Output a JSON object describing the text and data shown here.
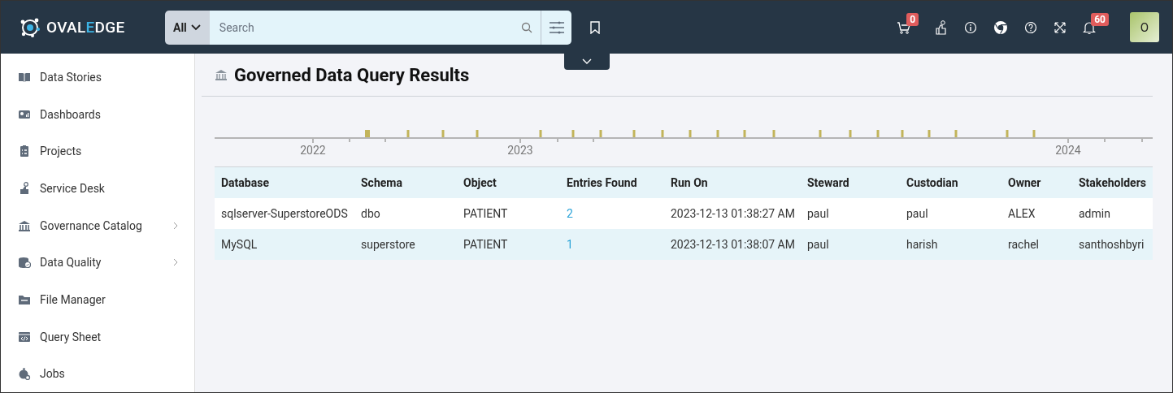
{
  "header": {
    "logo": [
      "OVAL",
      "E",
      "DGE"
    ],
    "search": {
      "scope": "All",
      "placeholder": "Search"
    },
    "cart_count": "0",
    "notification_count": "60",
    "avatar": "O"
  },
  "sidebar": {
    "items": [
      {
        "label": "Data Stories",
        "kind": "book",
        "expandable": false
      },
      {
        "label": "Dashboards",
        "kind": "dashboard",
        "expandable": false
      },
      {
        "label": "Projects",
        "kind": "clipboard",
        "expandable": false
      },
      {
        "label": "Service Desk",
        "kind": "hand",
        "expandable": false
      },
      {
        "label": "Governance Catalog",
        "kind": "bank",
        "expandable": true
      },
      {
        "label": "Data Quality",
        "kind": "database",
        "expandable": true
      },
      {
        "label": "File Manager",
        "kind": "folder",
        "expandable": false
      },
      {
        "label": "Query Sheet",
        "kind": "code",
        "expandable": false
      },
      {
        "label": "Jobs",
        "kind": "jobs",
        "expandable": false
      }
    ]
  },
  "page": {
    "title": "Governed Data Query Results"
  },
  "timeline": {
    "years": [
      "2022",
      "2023",
      "2024"
    ]
  },
  "table": {
    "columns": [
      "Database",
      "Schema",
      "Object",
      "Entries Found",
      "Run On",
      "Steward",
      "Custodian",
      "Owner",
      "Stakeholders"
    ],
    "rows": [
      [
        "sqlserver-SuperstoreODS",
        "dbo",
        "PATIENT",
        "2",
        "2023-12-13 01:38:27 AM",
        "paul",
        "paul",
        "ALEX",
        "admin"
      ],
      [
        "MySQL",
        "superstore",
        "PATIENT",
        "1",
        "2023-12-13 01:38:07 AM",
        "paul",
        "harish",
        "rachel",
        "santhoshbyri"
      ]
    ]
  }
}
